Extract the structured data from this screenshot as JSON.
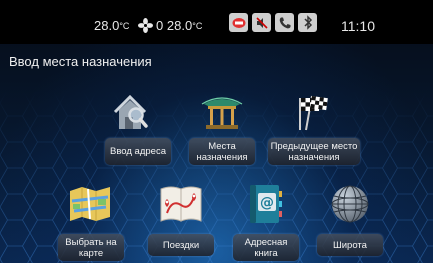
{
  "status": {
    "temp_left": "28.0",
    "temp_unit": "°C",
    "fan_level": "0",
    "temp_right": "28.0",
    "temp_unit_right": "°C",
    "icons": [
      "messages-icon",
      "mute-icon",
      "phone-icon",
      "bluetooth-icon"
    ],
    "time": "11:10"
  },
  "page_title": "Ввод места назначения",
  "tiles": [
    {
      "label": "Ввод адреса",
      "icon": "house-search-icon"
    },
    {
      "label": "Места назначения",
      "icon": "pavilion-icon"
    },
    {
      "label": "Предыдущее место назначения",
      "icon": "checkered-flags-icon"
    },
    {
      "label": "Выбрать на карте",
      "icon": "map-icon"
    },
    {
      "label": "Поездки",
      "icon": "route-book-icon"
    },
    {
      "label": "Адресная книга",
      "icon": "address-book-icon"
    },
    {
      "label": "Широта",
      "icon": "globe-icon"
    }
  ],
  "colors": {
    "status_bar": "#000000",
    "background_top": "#050b16",
    "background_glow": "#288ce6",
    "label_bg": "#3c4452",
    "text": "#f0f0f0"
  }
}
